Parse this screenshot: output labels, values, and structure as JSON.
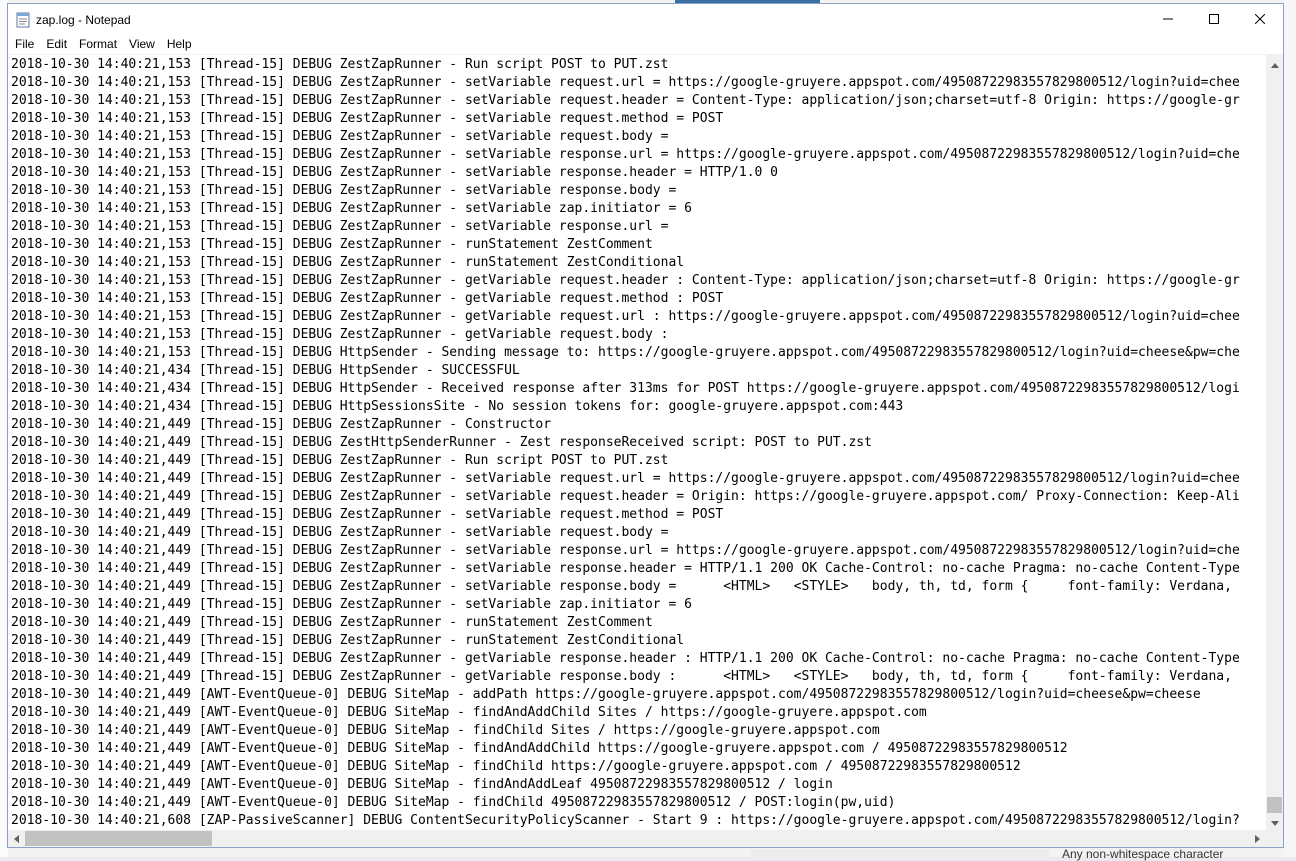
{
  "window": {
    "title": "zap.log - Notepad",
    "icon": "notepad-icon",
    "controls": {
      "minimize_icon": "minimize-icon",
      "maximize_icon": "maximize-icon",
      "close_icon": "close-icon"
    }
  },
  "menu": {
    "items": [
      {
        "label": "File"
      },
      {
        "label": "Edit"
      },
      {
        "label": "Format"
      },
      {
        "label": "View"
      },
      {
        "label": "Help"
      }
    ]
  },
  "background": {
    "bottom_text": "Any non-whitespace character"
  },
  "colors": {
    "window_border": "#8ba2c7",
    "scrollbar_track": "#f0f0f0",
    "scrollbar_thumb": "#c1c1c1"
  },
  "editor": {
    "lines": [
      "2018-10-30 14:40:21,153 [Thread-15] DEBUG ZestZapRunner - Run script POST to PUT.zst",
      "2018-10-30 14:40:21,153 [Thread-15] DEBUG ZestZapRunner - setVariable request.url = https://google-gruyere.appspot.com/4950872298355782980051‌2/login?uid=chee",
      "2018-10-30 14:40:21,153 [Thread-15] DEBUG ZestZapRunner - setVariable request.header = Content-Type: application/json;charset=utf-8 Origin: https://google-gr",
      "2018-10-30 14:40:21,153 [Thread-15] DEBUG ZestZapRunner - setVariable request.method = POST",
      "2018-10-30 14:40:21,153 [Thread-15] DEBUG ZestZapRunner - setVariable request.body =",
      "2018-10-30 14:40:21,153 [Thread-15] DEBUG ZestZapRunner - setVariable response.url = https://google-gruyere.appspot.com/495087229835578298005‌12/login?uid=che",
      "2018-10-30 14:40:21,153 [Thread-15] DEBUG ZestZapRunner - setVariable response.header = HTTP/1.0 0",
      "2018-10-30 14:40:21,153 [Thread-15] DEBUG ZestZapRunner - setVariable response.body =",
      "2018-10-30 14:40:21,153 [Thread-15] DEBUG ZestZapRunner - setVariable zap.initiator = 6",
      "2018-10-30 14:40:21,153 [Thread-15] DEBUG ZestZapRunner - setVariable response.url =",
      "2018-10-30 14:40:21,153 [Thread-15] DEBUG ZestZapRunner - runStatement ZestComment",
      "2018-10-30 14:40:21,153 [Thread-15] DEBUG ZestZapRunner - runStatement ZestConditional",
      "2018-10-30 14:40:21,153 [Thread-15] DEBUG ZestZapRunner - getVariable request.header : Content-Type: application/json;charset=utf-8 Origin: https://google-gr",
      "2018-10-30 14:40:21,153 [Thread-15] DEBUG ZestZapRunner - getVariable request.method : POST",
      "2018-10-30 14:40:21,153 [Thread-15] DEBUG ZestZapRunner - getVariable request.url : https://google-gruyere.appspot.com/495087229835578298005‌12/login?uid=chee",
      "2018-10-30 14:40:21,153 [Thread-15] DEBUG ZestZapRunner - getVariable request.body :",
      "2018-10-30 14:40:21,153 [Thread-15] DEBUG HttpSender - Sending message to: https://google-gruyere.appspot.com/495087229835578298005‌12/login?uid=cheese&pw=che",
      "2018-10-30 14:40:21,434 [Thread-15] DEBUG HttpSender - SUCCESSFUL",
      "2018-10-30 14:40:21,434 [Thread-15] DEBUG HttpSender - Received response after 313ms for POST https://google-gruyere.appspot.com/495087229835578298005‌12/logi",
      "2018-10-30 14:40:21,434 [Thread-15] DEBUG HttpSessionsSite - No session tokens for: google-gruyere.appspot.com:443",
      "2018-10-30 14:40:21,449 [Thread-15] DEBUG ZestZapRunner - Constructor",
      "2018-10-30 14:40:21,449 [Thread-15] DEBUG ZestHttpSenderRunner - Zest responseReceived script: POST to PUT.zst",
      "2018-10-30 14:40:21,449 [Thread-15] DEBUG ZestZapRunner - Run script POST to PUT.zst",
      "2018-10-30 14:40:21,449 [Thread-15] DEBUG ZestZapRunner - setVariable request.url = https://google-gruyere.appspot.com/495087229835578298005‌12/login?uid=chee",
      "2018-10-30 14:40:21,449 [Thread-15] DEBUG ZestZapRunner - setVariable request.header = Origin: https://google-gruyere.appspot.com/ Proxy-Connection: Keep-Ali",
      "2018-10-30 14:40:21,449 [Thread-15] DEBUG ZestZapRunner - setVariable request.method = POST",
      "2018-10-30 14:40:21,449 [Thread-15] DEBUG ZestZapRunner - setVariable request.body =",
      "2018-10-30 14:40:21,449 [Thread-15] DEBUG ZestZapRunner - setVariable response.url = https://google-gruyere.appspot.com/495087229835578298005‌12/login?uid=che",
      "2018-10-30 14:40:21,449 [Thread-15] DEBUG ZestZapRunner - setVariable response.header = HTTP/1.1 200 OK Cache-Control: no-cache Pragma: no-cache Content-Type",
      "2018-10-30 14:40:21,449 [Thread-15] DEBUG ZestZapRunner - setVariable response.body =      <HTML>   <STYLE>   body, th, td, form {     font-family: Verdana,",
      "2018-10-30 14:40:21,449 [Thread-15] DEBUG ZestZapRunner - setVariable zap.initiator = 6",
      "2018-10-30 14:40:21,449 [Thread-15] DEBUG ZestZapRunner - runStatement ZestComment",
      "2018-10-30 14:40:21,449 [Thread-15] DEBUG ZestZapRunner - runStatement ZestConditional",
      "2018-10-30 14:40:21,449 [Thread-15] DEBUG ZestZapRunner - getVariable response.header : HTTP/1.1 200 OK Cache-Control: no-cache Pragma: no-cache Content-Type",
      "2018-10-30 14:40:21,449 [Thread-15] DEBUG ZestZapRunner - getVariable response.body :      <HTML>   <STYLE>   body, th, td, form {     font-family: Verdana,",
      "2018-10-30 14:40:21,449 [AWT-EventQueue-0] DEBUG SiteMap - addPath https://google-gruyere.appspot.com/495087229835578298005‌12/login?uid=cheese&pw=cheese",
      "2018-10-30 14:40:21,449 [AWT-EventQueue-0] DEBUG SiteMap - findAndAddChild Sites / https://google-gruyere.appspot.com",
      "2018-10-30 14:40:21,449 [AWT-EventQueue-0] DEBUG SiteMap - findChild Sites / https://google-gruyere.appspot.com",
      "2018-10-30 14:40:21,449 [AWT-EventQueue-0] DEBUG SiteMap - findAndAddChild https://google-gruyere.appspot.com / 495087229835578298005‌12",
      "2018-10-30 14:40:21,449 [AWT-EventQueue-0] DEBUG SiteMap - findChild https://google-gruyere.appspot.com / 495087229835578298005‌12",
      "2018-10-30 14:40:21,449 [AWT-EventQueue-0] DEBUG SiteMap - findAndAddLeaf 495087229835578298005‌12 / login",
      "2018-10-30 14:40:21,449 [AWT-EventQueue-0] DEBUG SiteMap - findChild 495087229835578298005‌12 / POST:login(pw,uid)",
      "2018-10-30 14:40:21,608 [ZAP-PassiveScanner] DEBUG ContentSecurityPolicyScanner - Start 9 : https://google-gruyere.appspot.com/495087229835578298005‌12/login?"
    ]
  }
}
